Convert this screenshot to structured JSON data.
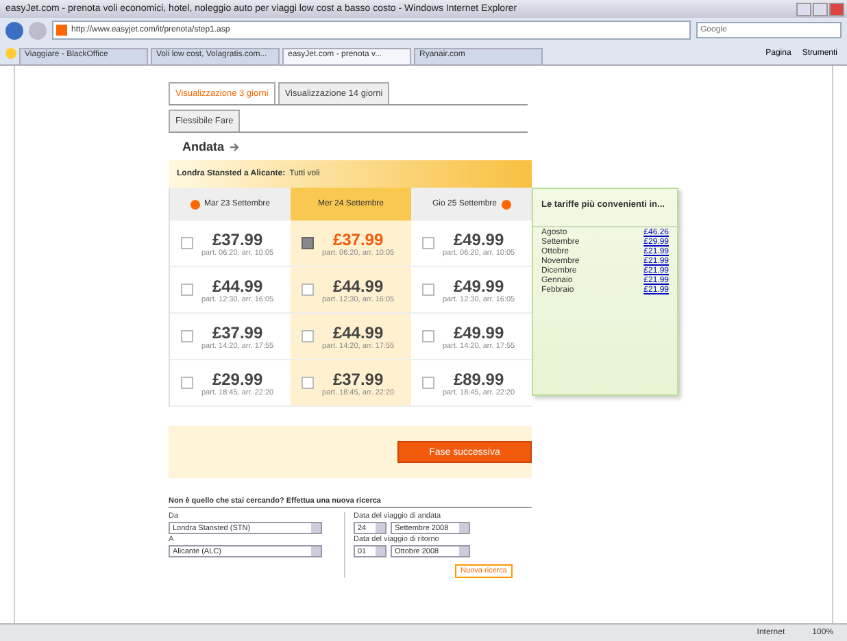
{
  "window": {
    "title": "easyJet.com - prenota voli economici, hotel, noleggio auto per viaggi low cost a basso costo - Windows Internet Explorer"
  },
  "address": "http://www.easyjet.com/it/prenota/step1.asp",
  "search": {
    "placeholder": "Google"
  },
  "browser_tabs": [
    {
      "label": "Viaggiare - BlackOffice",
      "selected": false
    },
    {
      "label": "Voli low cost, Volagratis.com...",
      "selected": false
    },
    {
      "label": "easyJet.com - prenota v...",
      "selected": true
    },
    {
      "label": "Ryanair.com",
      "selected": false
    }
  ],
  "toolbar": [
    "Pagina",
    "Strumenti"
  ],
  "view_tabs": [
    {
      "label": "Visualizzazione 3 giorni",
      "selected": true
    },
    {
      "label": "Visualizzazione 14 giorni",
      "selected": false
    }
  ],
  "fare_tab": "Flessibile Fare",
  "direction": "Andata",
  "route": {
    "name": "Londra Stansted a Alicante:",
    "note": "Tutti voli"
  },
  "days": [
    {
      "label": "Mar 23 Settembre",
      "selected": false,
      "flights": [
        {
          "price": "£37.99",
          "times": "part. 06:20, arr. 10:05",
          "checked": false
        },
        {
          "price": "£44.99",
          "times": "part. 12:30, arr. 16:05",
          "checked": false
        },
        {
          "price": "£37.99",
          "times": "part. 14:20, arr. 17:55",
          "checked": false
        },
        {
          "price": "£29.99",
          "times": "part. 18:45, arr. 22:20",
          "checked": false
        }
      ]
    },
    {
      "label": "Mer 24 Settembre",
      "selected": true,
      "flights": [
        {
          "price": "£37.99",
          "times": "part. 06:20, arr. 10:05",
          "checked": true
        },
        {
          "price": "£44.99",
          "times": "part. 12:30, arr. 16:05",
          "checked": false
        },
        {
          "price": "£44.99",
          "times": "part. 14:20, arr. 17:55",
          "checked": false
        },
        {
          "price": "£37.99",
          "times": "part. 18:45, arr. 22:20",
          "checked": false
        }
      ]
    },
    {
      "label": "Gio 25 Settembre",
      "selected": false,
      "flights": [
        {
          "price": "£49.99",
          "times": "part. 06:20, arr. 10:05",
          "checked": false
        },
        {
          "price": "£49.99",
          "times": "part. 12:30, arr. 16:05",
          "checked": false
        },
        {
          "price": "£49.99",
          "times": "part. 14:20, arr. 17:55",
          "checked": false
        },
        {
          "price": "£89.99",
          "times": "part. 18:45, arr. 22:20",
          "checked": false
        }
      ]
    }
  ],
  "cheapest": {
    "title": "Le tariffe più convenienti in...",
    "months": [
      {
        "month": "Agosto",
        "price": "£46.26"
      },
      {
        "month": "Settembre",
        "price": "£29.99"
      },
      {
        "month": "Ottobre",
        "price": "£21.99"
      },
      {
        "month": "Novembre",
        "price": "£21.99"
      },
      {
        "month": "Dicembre",
        "price": "£21.99"
      },
      {
        "month": "Gennaio",
        "price": "£21.99"
      },
      {
        "month": "Febbraio",
        "price": "£21.99"
      }
    ]
  },
  "next_button": "Fase successiva",
  "new_search": {
    "heading": "Non è quello che stai cercando? Effettua una nuova ricerca",
    "from_label": "Da",
    "from": "Londra Stansted (STN)",
    "to_label": "A",
    "to": "Alicante (ALC)",
    "out_label": "Data del viaggio di andata",
    "out_day": "24",
    "out_month": "Settembre 2008",
    "ret_label": "Data del viaggio di ritorno",
    "ret_day": "01",
    "ret_month": "Ottobre 2008",
    "button": "Nuova ricerca"
  },
  "status_bar": {
    "zone": "Internet",
    "zoom": "100%"
  }
}
